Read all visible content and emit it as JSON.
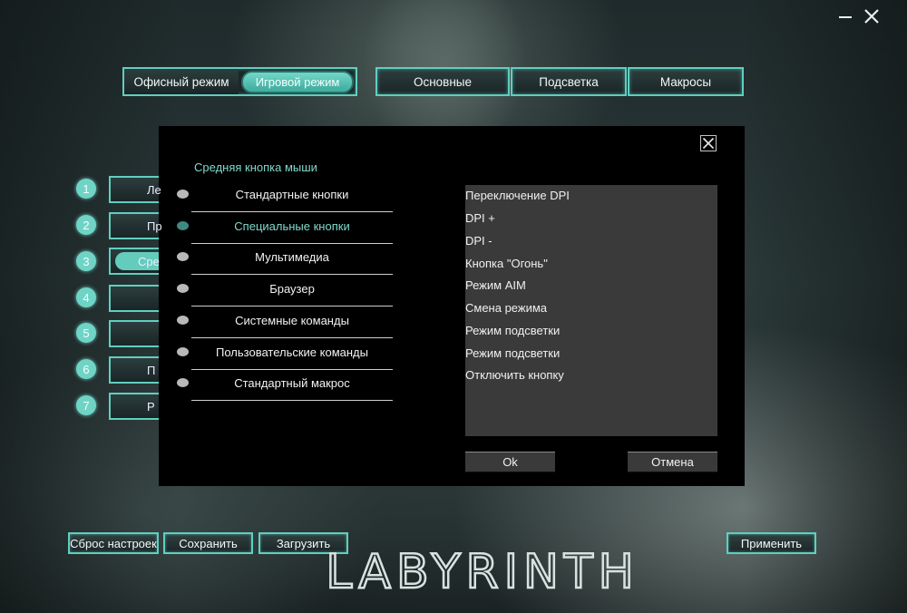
{
  "window": {
    "minimize_icon": "minimize-icon",
    "close_icon": "close-icon"
  },
  "mode_tabs": [
    {
      "label": "Офисный режим",
      "active": false
    },
    {
      "label": "Игровой режим",
      "active": true
    }
  ],
  "main_tabs": [
    {
      "label": "Основные"
    },
    {
      "label": "Подсветка"
    },
    {
      "label": "Макросы"
    }
  ],
  "side_buttons": [
    {
      "number": "1",
      "label": "Ле"
    },
    {
      "number": "2",
      "label": "Пр"
    },
    {
      "number": "3",
      "label": "Сре",
      "active": true
    },
    {
      "number": "4",
      "label": ""
    },
    {
      "number": "5",
      "label": ""
    },
    {
      "number": "6",
      "label": "П"
    },
    {
      "number": "7",
      "label": "Р"
    }
  ],
  "modal": {
    "title": "Средняя кнопка мыши",
    "categories": [
      {
        "label": "Стандартные кнопки"
      },
      {
        "label": "Специальные кнопки",
        "active": true
      },
      {
        "label": "Мультимедиа"
      },
      {
        "label": "Браузер"
      },
      {
        "label": "Системные команды"
      },
      {
        "label": "Пользовательские команды"
      },
      {
        "label": "Стандартный макрос"
      }
    ],
    "list_items": [
      "Переключение DPI",
      "DPI +",
      "DPI -",
      "Кнопка \"Огонь\"",
      "Режим AIM",
      "Смена режима",
      "Режим подсветки",
      "Режим подсветки",
      "Отключить кнопку"
    ],
    "ok_label": "Ok",
    "cancel_label": "Отмена"
  },
  "bottom": {
    "reset_label": "Сброс настроек",
    "save_label": "Сохранить",
    "load_label": "Загрузить",
    "apply_label": "Применить"
  },
  "logo_text": "LABYRINTH",
  "colors": {
    "accent": "#5fcfc0",
    "modal_bg": "#000000",
    "list_bg": "#3a3a3a"
  }
}
